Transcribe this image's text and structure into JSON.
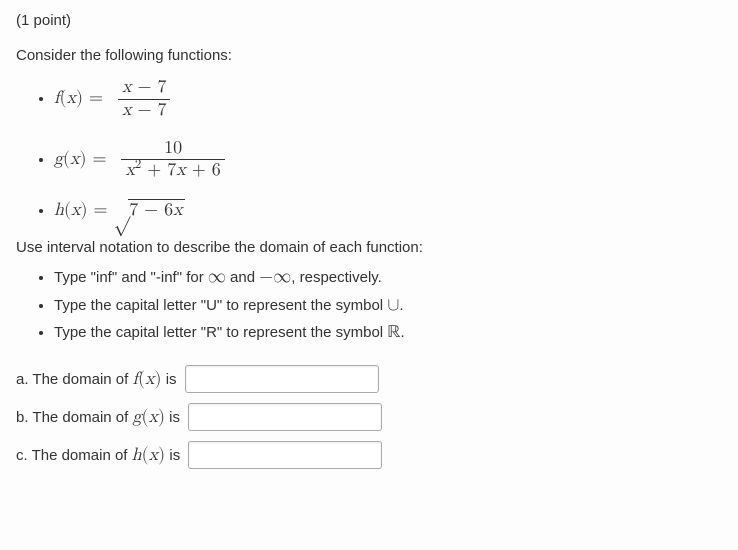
{
  "points_label": "(1 point)",
  "intro": "Consider the following functions:",
  "func_labels": {
    "f": "f",
    "g": "g",
    "h": "h",
    "x": "x"
  },
  "f": {
    "num_const": "7",
    "den_const": "7"
  },
  "g": {
    "num": "10",
    "den_b": "7",
    "den_c": "6"
  },
  "h": {
    "radicand_a": "7",
    "radicand_b": "6"
  },
  "domain_prompt": "Use interval notation to describe the domain of each function:",
  "instructions": [
    {
      "pre": "Type \"inf\" and \"-inf\" for ",
      "sym1": "∞",
      "mid": " and ",
      "sym2": "−∞",
      "post": ", respectively."
    },
    {
      "pre": "Type the capital letter \"U\" to represent the symbol ",
      "sym": "∪",
      "post": "."
    },
    {
      "pre": "Type the capital letter \"R\" to represent the symbol ",
      "sym": "ℝ",
      "post": "."
    }
  ],
  "answers": {
    "a": {
      "letter": "a.",
      "text": " The domain of ",
      "fn": "f",
      "tail": " is"
    },
    "b": {
      "letter": "b.",
      "text": " The domain of ",
      "fn": "g",
      "tail": " is"
    },
    "c": {
      "letter": "c.",
      "text": " The domain of ",
      "fn": "h",
      "tail": " is"
    }
  }
}
